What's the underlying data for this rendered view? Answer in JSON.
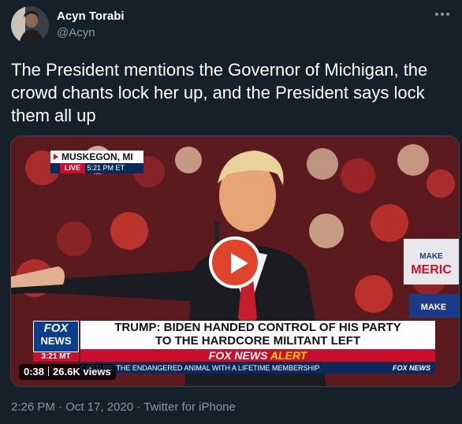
{
  "author": {
    "name": "Acyn Torabi",
    "handle": "@Acyn"
  },
  "tweet_text": "The President mentions the Governor of Michigan, the crowd chants lock her up, and the President says lock them all up",
  "video": {
    "location": "MUSKEGON, MI",
    "live_label": "LIVE",
    "live_time": "5:21 PM ET",
    "headline_line1": "TRUMP: BIDEN HANDED CONTROL OF HIS PARTY",
    "headline_line2": "TO THE HARDCORE MILITANT LEFT",
    "alert_prefix": "FOX NEWS",
    "alert_word": "ALERT",
    "logo_line1": "FOX",
    "logo_line2": "NEWS",
    "channel_time": "3:21 MT",
    "ticker_text": "CAPTURE THE ENDANGERED ANIMAL WITH A LIFETIME MEMBERSHIP",
    "ticker_brand": "FOX NEWS",
    "sign_text_1": "MAKE",
    "sign_text_2": "MERIC",
    "sign_text_3": "MAKE",
    "duration": "0:38",
    "views": "26.6K views"
  },
  "timestamp": "2:26 PM · Oct 17, 2020 · Twitter for iPhone",
  "icons": {
    "more": "more-dots-icon",
    "play": "play-icon"
  },
  "colors": {
    "background": "#15202b",
    "secondary_text": "#8899a6",
    "play_button": "#e0452b"
  }
}
